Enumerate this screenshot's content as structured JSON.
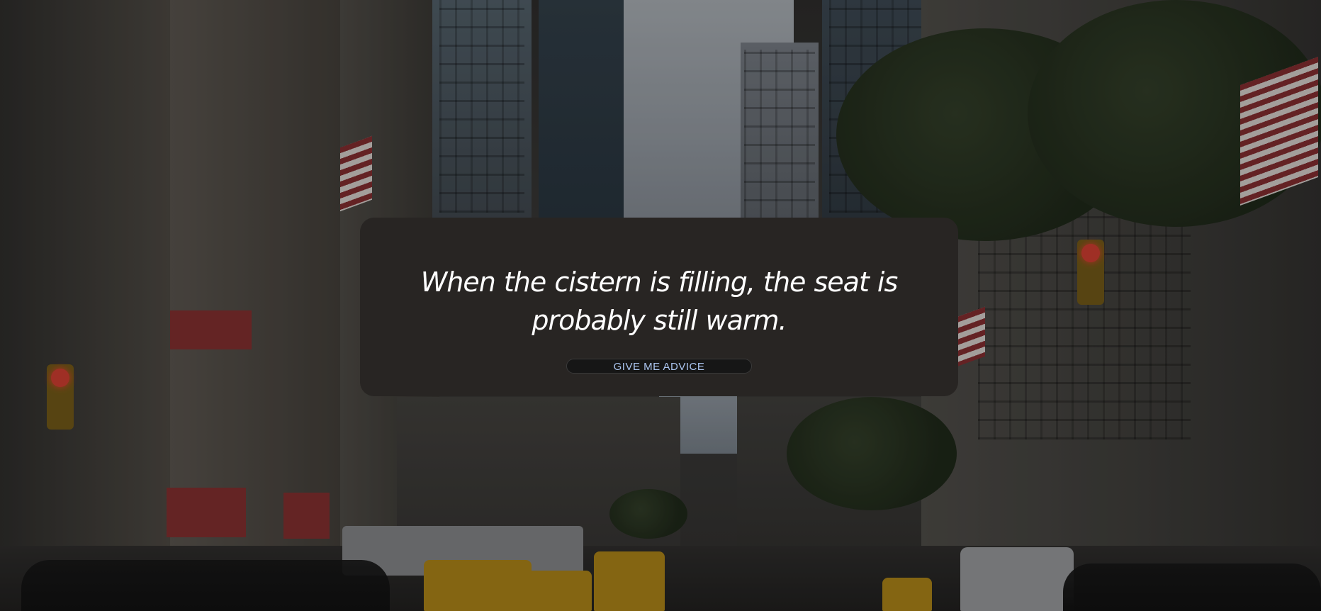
{
  "advice": {
    "quote": "When the cistern is filling, the seat is probably still warm.",
    "button_label": "GIVE ME ADVICE"
  },
  "colors": {
    "card_background": "#282523",
    "quote_text": "#ffffff",
    "button_text": "#aac4ee",
    "button_background": "#161616"
  },
  "background": {
    "scene": "city-street-photo"
  }
}
